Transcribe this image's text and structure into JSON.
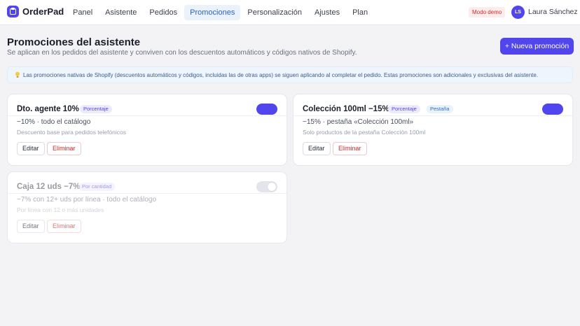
{
  "app": {
    "name": "OrderPad"
  },
  "nav": {
    "items": [
      {
        "label": "Panel",
        "active": false
      },
      {
        "label": "Asistente",
        "active": false
      },
      {
        "label": "Pedidos",
        "active": false
      },
      {
        "label": "Promociones",
        "active": true
      },
      {
        "label": "Personalización",
        "active": false
      },
      {
        "label": "Ajustes",
        "active": false
      },
      {
        "label": "Plan",
        "active": false
      }
    ]
  },
  "header": {
    "demo_badge": "Modo demo",
    "user_initials": "LS",
    "user_name": "Laura Sánchez"
  },
  "page": {
    "title": "Promociones del asistente",
    "subtitle": "Se aplican en los pedidos del asistente y conviven con los descuentos automáticos y códigos nativos de Shopify.",
    "new_button": "+ Nueva promoción",
    "info": "Las promociones nativas de Shopify (descuentos automáticos y códigos, incluidas las de otras apps) se siguen aplicando al completar el pedido. Estas promociones son adicionales y exclusivas del asistente."
  },
  "colors": {
    "accent": "#5146ee",
    "danger": "#d22d2d",
    "info_bg": "#eef5fd"
  },
  "promotions": [
    {
      "title": "Dto. agente 10%",
      "tags": [
        {
          "label": "Porcentaje",
          "color": "violet"
        }
      ],
      "description": "−10% · todo el catálogo",
      "note": "Descuento base para pedidos telefónicos",
      "enabled": true,
      "edit_label": "Editar",
      "delete_label": "Eliminar"
    },
    {
      "title": "Colección 100ml −15%",
      "tags": [
        {
          "label": "Porcentaje",
          "color": "violet"
        },
        {
          "label": "Pestaña",
          "color": "blue"
        }
      ],
      "description": "−15% · pestaña «Colección 100ml»",
      "note": "Solo productos de la pestaña Colección 100ml",
      "enabled": true,
      "edit_label": "Editar",
      "delete_label": "Eliminar"
    },
    {
      "title": "Caja 12 uds −7%",
      "tags": [
        {
          "label": "Por cantidad",
          "color": "violet"
        }
      ],
      "description": "−7% con 12+ uds por línea · todo el catálogo",
      "note": "Por línea con 12 o más unidades",
      "enabled": false,
      "edit_label": "Editar",
      "delete_label": "Eliminar"
    }
  ]
}
